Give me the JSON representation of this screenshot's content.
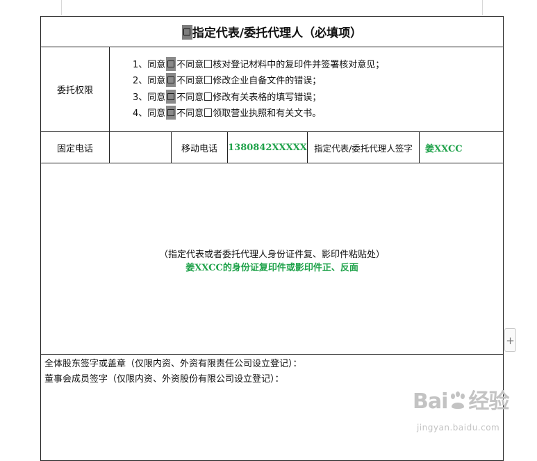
{
  "form": {
    "title": "指定代表/委托代理人（必填项）",
    "permissions": {
      "label": "委托权限",
      "items": [
        {
          "num": "1、同意",
          "mid": "不同意",
          "text": "核对登记材料中的复印件并签署核对意见；"
        },
        {
          "num": "2、同意",
          "mid": "不同意",
          "text": "修改企业自备文件的错误；"
        },
        {
          "num": "3、同意",
          "mid": "不同意",
          "text": "修改有关表格的填写错误；"
        },
        {
          "num": "4、同意",
          "mid": "不同意",
          "text": "领取营业执照和有关文书。"
        }
      ]
    },
    "contact": {
      "landline_label": "固定电话",
      "landline_value": "",
      "mobile_label": "移动电话",
      "mobile_value": "1380842XXXXX",
      "signature_label": "指定代表/委托代理人签字",
      "signature_value": "姜XXCC"
    },
    "id_area": {
      "note": "（指定代表或者委托代理人身份证件复、影印件粘贴处）",
      "filled": "姜XXCC的身份证复印件或影印件正、反面"
    },
    "shareholders": {
      "line1": "全体股东签字或盖章（仅限内资、外资有限责任公司设立登记）：",
      "line2": "董事会成员签字（仅限内资、外资股份有限公司设立登记）："
    }
  },
  "watermark": {
    "brand": "Bai",
    "brand_suffix": "经验",
    "url": "jingyan.baidu.com"
  },
  "handle": {
    "symbol": "+"
  }
}
